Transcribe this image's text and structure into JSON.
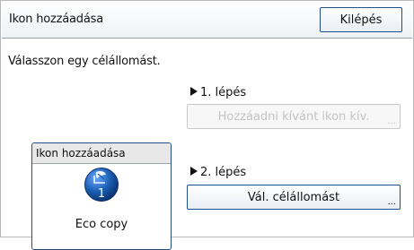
{
  "window": {
    "title": "Ikon hozzáadása",
    "exit_label": "Kilépés"
  },
  "main": {
    "instruction": "Válasszon egy célállomást.",
    "icon_panel": {
      "title": "Ikon hozzáadása",
      "icon_number": "1",
      "icon_name": "Eco copy",
      "icon_symbol": "eco-copy-icon"
    },
    "step1": {
      "label": "1. lépés",
      "button_label": "Hozzáadni kívánt ikon kív.",
      "button_ellipsis": "...",
      "enabled": false
    },
    "step2": {
      "label": "2. lépés",
      "button_label": "Vál. célállomást",
      "button_ellipsis": "...",
      "enabled": true
    }
  },
  "colors": {
    "accent_border": "#1f4f8a",
    "icon_blue": "#1a5fb4",
    "disabled_text": "#c3c3c3"
  }
}
